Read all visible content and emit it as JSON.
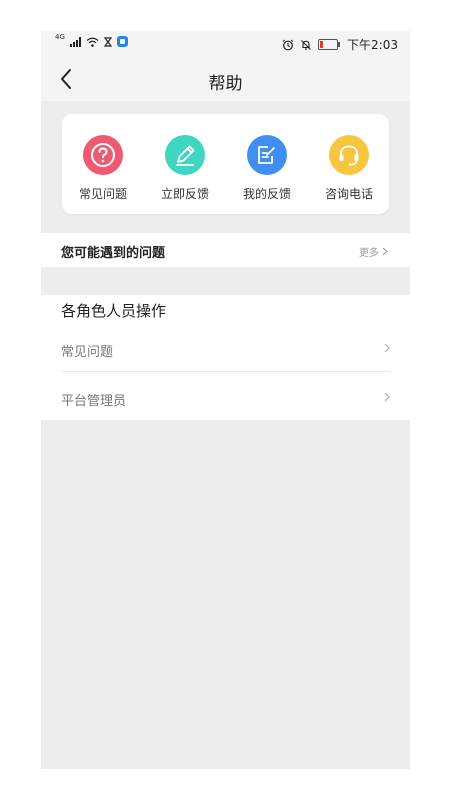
{
  "statusbar": {
    "network": "4G",
    "time": "下午2:03"
  },
  "header": {
    "title": "帮助"
  },
  "quick_actions": [
    {
      "label": "常见问题",
      "icon": "question-icon",
      "color": "#ef5a73"
    },
    {
      "label": "立即反馈",
      "icon": "pencil-icon",
      "color": "#3fd6bf"
    },
    {
      "label": "我的反馈",
      "icon": "note-icon",
      "color": "#3f8ff0"
    },
    {
      "label": "咨询电话",
      "icon": "headset-icon",
      "color": "#f7c63f"
    }
  ],
  "faq_section": {
    "title": "您可能遇到的问题",
    "more_label": "更多"
  },
  "roles_section": {
    "title": "各角色人员操作",
    "items": [
      {
        "label": "常见问题"
      },
      {
        "label": "平台管理员"
      }
    ]
  }
}
